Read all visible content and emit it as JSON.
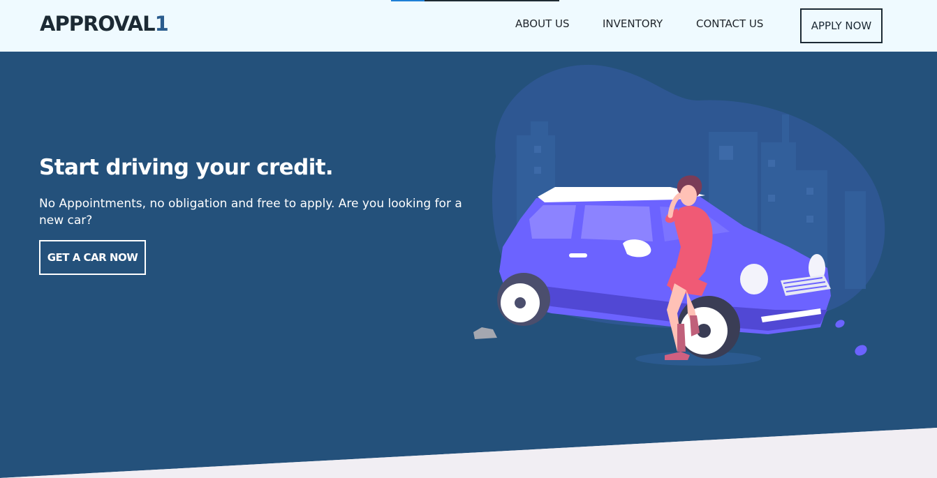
{
  "header": {
    "logo_text": "APPROVAL",
    "logo_accent": "1",
    "nav": {
      "about": "ABOUT US",
      "inventory": "INVENTORY",
      "contact": "CONTACT US"
    },
    "apply_label": "APPLY NOW",
    "progress": 0.2
  },
  "hero": {
    "title": "Start driving your credit.",
    "subtitle": "No Appointments, no obligation and free to apply. Are you looking for a new car?",
    "cta_label": "GET A CAR NOW"
  },
  "colors": {
    "topbar_bg": "#effaff",
    "hero_bg": "#24517b",
    "car": "#6c63ff",
    "accent_blue": "#2a5c8e",
    "person_dress": "#f05a75"
  },
  "icons": {
    "illustration": "woman-leaning-on-car-illustration"
  }
}
